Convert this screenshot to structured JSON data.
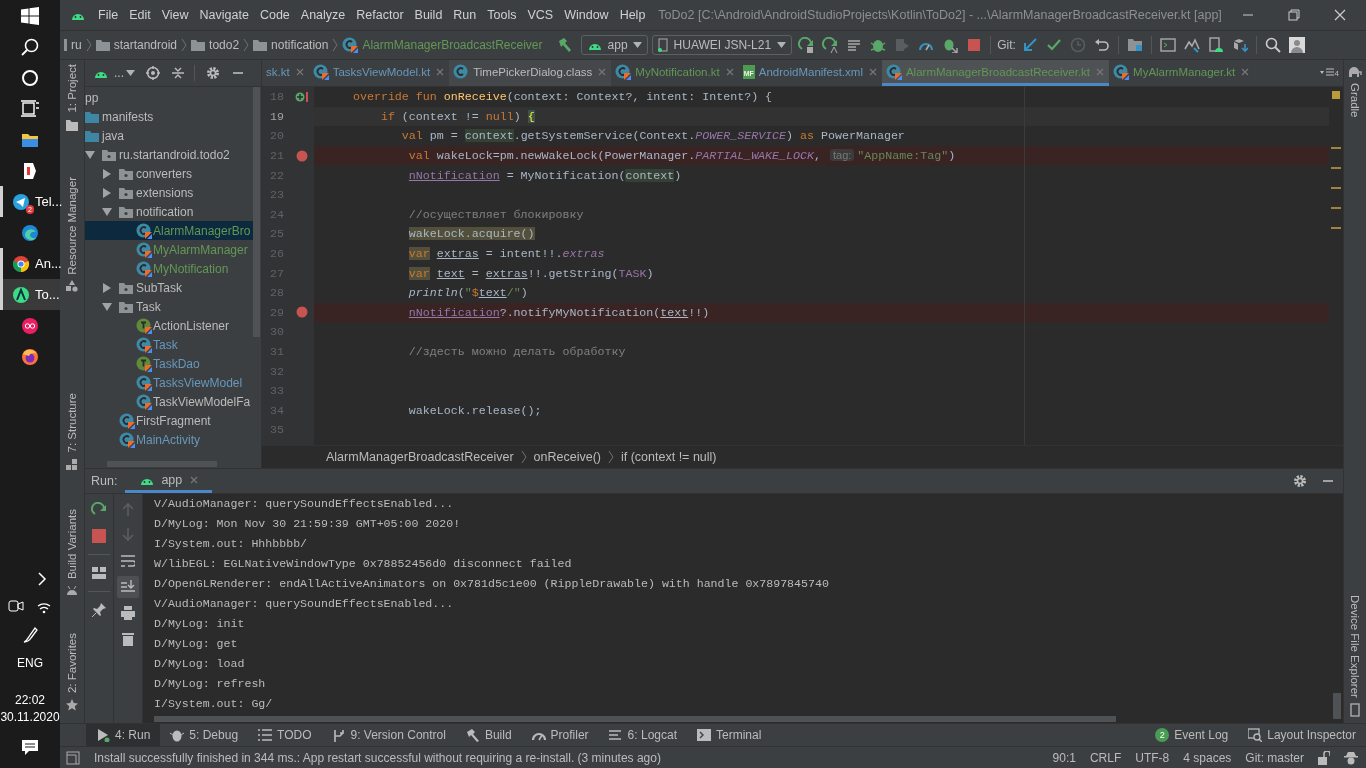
{
  "taskbar": {
    "apps": [
      {
        "running": false,
        "selected": false
      },
      {
        "running": false,
        "selected": false
      },
      {
        "label": "Tel...",
        "badge": "2",
        "running": true,
        "selected": false
      },
      {
        "running": false,
        "selected": false
      },
      {
        "label": "An...",
        "running": true,
        "selected": false
      },
      {
        "label": "To...",
        "running": true,
        "selected": true
      },
      {
        "running": false,
        "selected": false
      },
      {
        "running": false,
        "selected": false
      }
    ],
    "language": "ENG",
    "time": "22:02",
    "date": "30.11.2020"
  },
  "menu_bar": {
    "items": [
      "File",
      "Edit",
      "View",
      "Navigate",
      "Code",
      "Analyze",
      "Refactor",
      "Build",
      "Run",
      "Tools",
      "VCS",
      "Window",
      "Help"
    ],
    "title": "ToDo2 [C:\\Android\\AndroidStudioProjects\\Kotlin\\ToDo2] - ...\\AlarmManagerBroadcastReceiver.kt [app]"
  },
  "nav_bar": {
    "breadcrumbs": [
      {
        "label": "ru",
        "kind": "folder"
      },
      {
        "label": "startandroid",
        "kind": "folder"
      },
      {
        "label": "todo2",
        "kind": "folder"
      },
      {
        "label": "notification",
        "kind": "folder"
      },
      {
        "label": "AlarmManagerBroadcastReceiver",
        "kind": "class"
      }
    ],
    "run_config": "app",
    "device": "HUAWEI JSN-L21",
    "git_label": "Git:"
  },
  "left_tool_strip": [
    {
      "label": "1: Project"
    },
    {
      "label": "Resource Manager"
    },
    {
      "label": "7: Structure"
    },
    {
      "label": "Build Variants"
    },
    {
      "label": "2: Favorites"
    }
  ],
  "right_tool_strip": [
    "Gradle",
    "Device File Explorer"
  ],
  "project": {
    "view": "...",
    "tree": [
      {
        "label": "pp",
        "selected": false,
        "color": "#bbbbbb",
        "children": [
          {
            "label": "manifests",
            "kind": "source-folder",
            "selected": false,
            "color": "#bbbbbb"
          },
          {
            "label": "java",
            "kind": "source-folder",
            "selected": false,
            "color": "#bbbbbb",
            "children": [
              {
                "label": "ru.startandroid.todo2",
                "kind": "package",
                "selected": false,
                "color": "#bbbbbb",
                "expanded": true,
                "children": [
                  {
                    "label": "converters",
                    "kind": "package",
                    "selected": false,
                    "color": "#bbbbbb",
                    "expanded": false
                  },
                  {
                    "label": "extensions",
                    "kind": "package",
                    "selected": false,
                    "color": "#bbbbbb",
                    "expanded": false
                  },
                  {
                    "label": "notification",
                    "kind": "package",
                    "selected": false,
                    "color": "#bbbbbb",
                    "expanded": true,
                    "children": [
                      {
                        "label": "AlarmManagerBro",
                        "kind": "class",
                        "selected": true,
                        "color": "#629755"
                      },
                      {
                        "label": "MyAlarmManager",
                        "kind": "class",
                        "selected": false,
                        "color": "#629755"
                      },
                      {
                        "label": "MyNotification",
                        "kind": "class",
                        "selected": false,
                        "color": "#629755"
                      }
                    ]
                  },
                  {
                    "label": "SubTask",
                    "kind": "package",
                    "selected": false,
                    "color": "#bbbbbb",
                    "expanded": false
                  },
                  {
                    "label": "Task",
                    "kind": "package",
                    "selected": false,
                    "color": "#bbbbbb",
                    "expanded": true,
                    "children": [
                      {
                        "label": "ActionListener",
                        "kind": "interface",
                        "selected": false,
                        "color": "#bbbbbb"
                      },
                      {
                        "label": "Task",
                        "kind": "class",
                        "selected": false,
                        "color": "#6897bb"
                      },
                      {
                        "label": "TaskDao",
                        "kind": "interface",
                        "selected": false,
                        "color": "#6897bb"
                      },
                      {
                        "label": "TasksViewModel",
                        "kind": "class",
                        "selected": false,
                        "color": "#6897bb"
                      },
                      {
                        "label": "TaskViewModelFa",
                        "kind": "class",
                        "selected": false,
                        "color": "#bbbbbb"
                      }
                    ]
                  },
                  {
                    "label": "FirstFragment",
                    "kind": "class",
                    "selected": false,
                    "color": "#bbbbbb"
                  },
                  {
                    "label": "MainActivity",
                    "kind": "class",
                    "selected": false,
                    "color": "#6897bb"
                  }
                ]
              }
            ]
          }
        ]
      }
    ]
  },
  "editor": {
    "tabs": [
      {
        "label": "sk.kt",
        "kind": "cut",
        "selected": false,
        "color": "#6897bb"
      },
      {
        "label": "TasksViewModel.kt",
        "kind": "kotlin",
        "selected": false,
        "color": "#6897bb"
      },
      {
        "label": "TimePickerDialog.class",
        "kind": "class",
        "selected": false,
        "color": "#bbbbbb"
      },
      {
        "label": "MyNotification.kt",
        "kind": "kotlin",
        "selected": false,
        "color": "#629755"
      },
      {
        "label": "AndroidManifest.xml",
        "kind": "manifest",
        "icon_label": "MF",
        "selected": false,
        "color": "#6897bb"
      },
      {
        "label": "AlarmManagerBroadcastReceiver.kt",
        "kind": "kotlin",
        "selected": true,
        "color": "#629755"
      },
      {
        "label": "MyAlarmManager.kt",
        "kind": "kotlin",
        "selected": false,
        "color": "#629755"
      }
    ],
    "hidden_tabs": "4",
    "lines": [
      {
        "number": "18",
        "breakpoint": false,
        "override": true,
        "current": false,
        "tokens": [
          {
            "kind": "kw",
            "text": "    override fun "
          },
          {
            "kind": "fn",
            "text": "onReceive"
          },
          {
            "kind": "plain",
            "text": "(context: Context?, intent: Intent?) {"
          }
        ]
      },
      {
        "number": "19",
        "breakpoint": false,
        "override": false,
        "current": true,
        "tokens": [
          {
            "kind": "kw",
            "text": "        if "
          },
          {
            "kind": "plain",
            "text": "(context != "
          },
          {
            "kind": "kw",
            "text": "null"
          },
          {
            "kind": "plain",
            "text": ") "
          },
          {
            "kind": "brace",
            "text": "{"
          }
        ]
      },
      {
        "number": "20",
        "breakpoint": false,
        "override": false,
        "current": false,
        "tokens": [
          {
            "kind": "kw",
            "text": "           val "
          },
          {
            "kind": "plain",
            "text": "pm = "
          },
          {
            "kind": "smart",
            "text": "context"
          },
          {
            "kind": "plain",
            "text": ".getSystemService(Context."
          },
          {
            "kind": "field",
            "text": "POWER_SERVICE"
          },
          {
            "kind": "plain",
            "text": ") "
          },
          {
            "kind": "kw",
            "text": "as "
          },
          {
            "kind": "plain",
            "text": "PowerManager"
          }
        ]
      },
      {
        "number": "21",
        "breakpoint": true,
        "override": false,
        "current": false,
        "tokens": [
          {
            "kind": "kw",
            "text": "            val "
          },
          {
            "kind": "plain",
            "text": "wakeLock=pm.newWakeLock(PowerManager."
          },
          {
            "kind": "field",
            "text": "PARTIAL_WAKE_LOCK"
          },
          {
            "kind": "plain",
            "text": ", "
          },
          {
            "kind": "hint",
            "text": "tag:"
          },
          {
            "kind": "str",
            "text": "\"AppName:Tag\""
          },
          {
            "kind": "plain",
            "text": ")"
          }
        ]
      },
      {
        "number": "22",
        "breakpoint": false,
        "override": false,
        "current": false,
        "tokens": [
          {
            "kind": "prop",
            "text": "            nNotification"
          },
          {
            "kind": "plain",
            "text": " = MyNotification("
          },
          {
            "kind": "smart",
            "text": "context"
          },
          {
            "kind": "plain",
            "text": ")"
          }
        ]
      },
      {
        "number": "23",
        "breakpoint": false,
        "override": false,
        "current": false
      },
      {
        "number": "24",
        "breakpoint": false,
        "override": false,
        "current": false,
        "tokens": [
          {
            "kind": "comment",
            "text": "            //осуществляет блокировку"
          }
        ]
      },
      {
        "number": "25",
        "breakpoint": false,
        "override": false,
        "current": false,
        "tokens": [
          {
            "kind": "marked",
            "text": "            wakeLock.acquire()"
          }
        ]
      },
      {
        "number": "26",
        "breakpoint": false,
        "override": false,
        "current": false,
        "tokens": [
          {
            "kind": "markedkw",
            "text": "            var"
          },
          {
            "kind": "var",
            "text": " extras"
          },
          {
            "kind": "plain",
            "text": " = intent!!."
          },
          {
            "kind": "field",
            "text": "extras"
          }
        ]
      },
      {
        "number": "27",
        "breakpoint": false,
        "override": false,
        "current": false,
        "tokens": [
          {
            "kind": "markedkw",
            "text": "            var"
          },
          {
            "kind": "var",
            "text": " text"
          },
          {
            "kind": "plain",
            "text": " = "
          },
          {
            "kind": "var",
            "text": "extras"
          },
          {
            "kind": "plain",
            "text": "!!.getString("
          },
          {
            "kind": "const",
            "text": "TASK"
          },
          {
            "kind": "plain",
            "text": ")"
          }
        ]
      },
      {
        "number": "28",
        "breakpoint": false,
        "override": false,
        "current": false,
        "tokens": [
          {
            "kind": "italic",
            "text": "            println"
          },
          {
            "kind": "plain",
            "text": "("
          },
          {
            "kind": "str",
            "text": "\""
          },
          {
            "kind": "kw",
            "text": "$"
          },
          {
            "kind": "var",
            "text": "text"
          },
          {
            "kind": "str",
            "text": "/\""
          },
          {
            "kind": "plain",
            "text": ")"
          }
        ]
      },
      {
        "number": "29",
        "breakpoint": true,
        "override": false,
        "current": false,
        "tokens": [
          {
            "kind": "prop",
            "text": "            nNotification"
          },
          {
            "kind": "plain",
            "text": "?.notifyMyNotification("
          },
          {
            "kind": "var",
            "text": "text"
          },
          {
            "kind": "plain",
            "text": "!!)"
          }
        ]
      },
      {
        "number": "30",
        "breakpoint": false,
        "override": false,
        "current": false
      },
      {
        "number": "31",
        "breakpoint": false,
        "override": false,
        "current": false,
        "tokens": [
          {
            "kind": "comment",
            "text": "            //здесть можно делать обработку"
          }
        ]
      },
      {
        "number": "32",
        "breakpoint": false,
        "override": false,
        "current": false
      },
      {
        "number": "33",
        "breakpoint": false,
        "override": false,
        "current": false
      },
      {
        "number": "34",
        "breakpoint": false,
        "override": false,
        "current": false,
        "tokens": [
          {
            "kind": "plain",
            "text": "            wakeLock.release();"
          }
        ]
      },
      {
        "number": "35",
        "breakpoint": false,
        "override": false,
        "current": false
      }
    ],
    "breadcrumbs": [
      "AlarmManagerBroadcastReceiver",
      "onReceive()",
      "if (context != null)"
    ]
  },
  "run": {
    "label": "Run:",
    "tabs": [
      {
        "label": "app",
        "selected": true
      }
    ],
    "log": [
      "V/AudioManager: querySoundEffectsEnabled...",
      "D/MyLog: Mon Nov 30 21:59:39 GMT+05:00 2020!",
      "I/System.out: Hhhbbbb/",
      "W/libEGL: EGLNativeWindowType 0x78852456d0 disconnect failed",
      "D/OpenGLRenderer: endAllActiveAnimators on 0x781d5c1e00 (RippleDrawable) with handle 0x7897845740",
      "V/AudioManager: querySoundEffectsEnabled...",
      "D/MyLog: init",
      "D/MyLog: get",
      "D/MyLog: load",
      "D/MyLog: refresh",
      "I/System.out: Gg/"
    ]
  },
  "tool_tabs": [
    {
      "label": "4: Run",
      "kind": "run",
      "selected": true
    },
    {
      "label": "5: Debug",
      "kind": "debug",
      "selected": false
    },
    {
      "label": "TODO",
      "kind": "todo",
      "selected": false
    },
    {
      "label": "9: Version Control",
      "kind": "vcs",
      "selected": false
    },
    {
      "label": "Build",
      "kind": "build",
      "selected": false
    },
    {
      "label": "Profiler",
      "kind": "profiler",
      "selected": false
    },
    {
      "label": "6: Logcat",
      "kind": "logcat",
      "selected": false
    },
    {
      "label": "Terminal",
      "kind": "terminal",
      "selected": false
    }
  ],
  "tool_tabs_right": [
    {
      "label": "Event Log",
      "badge": "2"
    },
    {
      "label": "Layout Inspector"
    }
  ],
  "status_bar": {
    "message": "Install successfully finished in 344 ms.: App restart successful without requiring a re-install. (3 minutes ago)",
    "items": [
      "90:1",
      "CRLF",
      "UTF-8",
      "4 spaces",
      "Git: master"
    ]
  }
}
